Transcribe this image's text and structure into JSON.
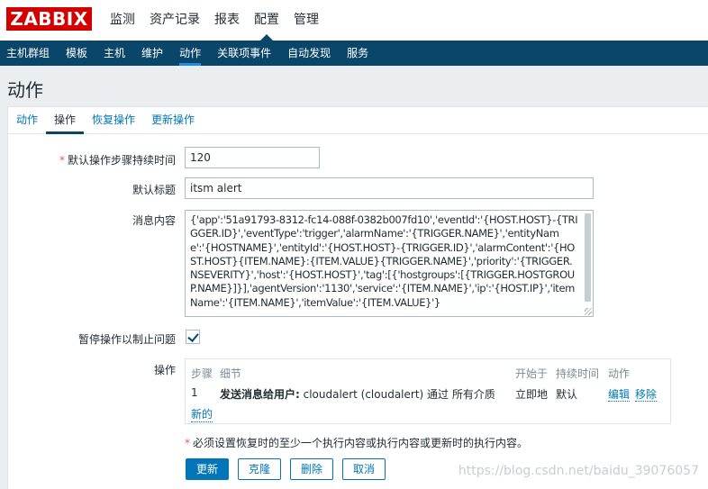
{
  "header": {
    "logo": "ZABBIX",
    "menu": [
      "监测",
      "资产记录",
      "报表",
      "配置",
      "管理"
    ],
    "active_menu": "配置"
  },
  "submenu": {
    "items": [
      "主机群组",
      "模板",
      "主机",
      "维护",
      "动作",
      "关联项事件",
      "自动发现",
      "服务"
    ],
    "active": "动作"
  },
  "page": {
    "title": "动作"
  },
  "tabs": [
    "动作",
    "操作",
    "恢复操作",
    "更新操作"
  ],
  "form": {
    "step_duration_label": "默认操作步骤持续时间",
    "step_duration_value": "120",
    "subject_label": "默认标题",
    "subject_value": "itsm alert",
    "message_label": "消息内容",
    "message_value": "{'app':'51a91793-8312-fc14-088f-0382b007fd10','eventId':'{HOST.HOST}-{TRIGGER.ID}','eventType':'trigger','alarmName':'{TRIGGER.NAME}','entityName':'{HOSTNAME}','entityId':'{HOST.HOST}-{TRIGGER.ID}','alarmContent':'{HOST.HOST}{ITEM.NAME}:{ITEM.VALUE}{TRIGGER.NAME}','priority':'{TRIGGER.NSEVERITY}','host':'{HOST.HOST}','tag':[{'hostgroups':[{TRIGGER.HOSTGROUP.NAME}]}],'agentVersion':'1130','service':'{ITEM.NAME}','ip':'{HOST.IP}','itemName':'{ITEM.NAME}','itemValue':'{ITEM.VALUE}'}",
    "pause_label": "暂停操作以制止问题",
    "pause_checked": true,
    "operations_label": "操作",
    "operations": {
      "columns": [
        "步骤",
        "细节",
        "开始于",
        "持续时间",
        "动作"
      ],
      "rows": [
        {
          "step": "1",
          "detail_bold": "发送消息给用户:",
          "detail_rest": " cloudalert (cloudalert) 通过 所有介质",
          "start": "立即地",
          "duration": "默认",
          "edit": "编辑",
          "remove": "移除"
        }
      ],
      "new_label": "新的"
    },
    "note": "必须设置恢复时的至少一个执行内容或执行内容或更新时的执行内容。"
  },
  "buttons": {
    "update": "更新",
    "clone": "克隆",
    "delete": "删除",
    "cancel": "取消"
  },
  "watermark": "https://blog.csdn.net/baidu_39076057",
  "colors": {
    "brand": "#d40000",
    "nav": "#0a466a",
    "link": "#0275b8",
    "required": "#e45959"
  }
}
